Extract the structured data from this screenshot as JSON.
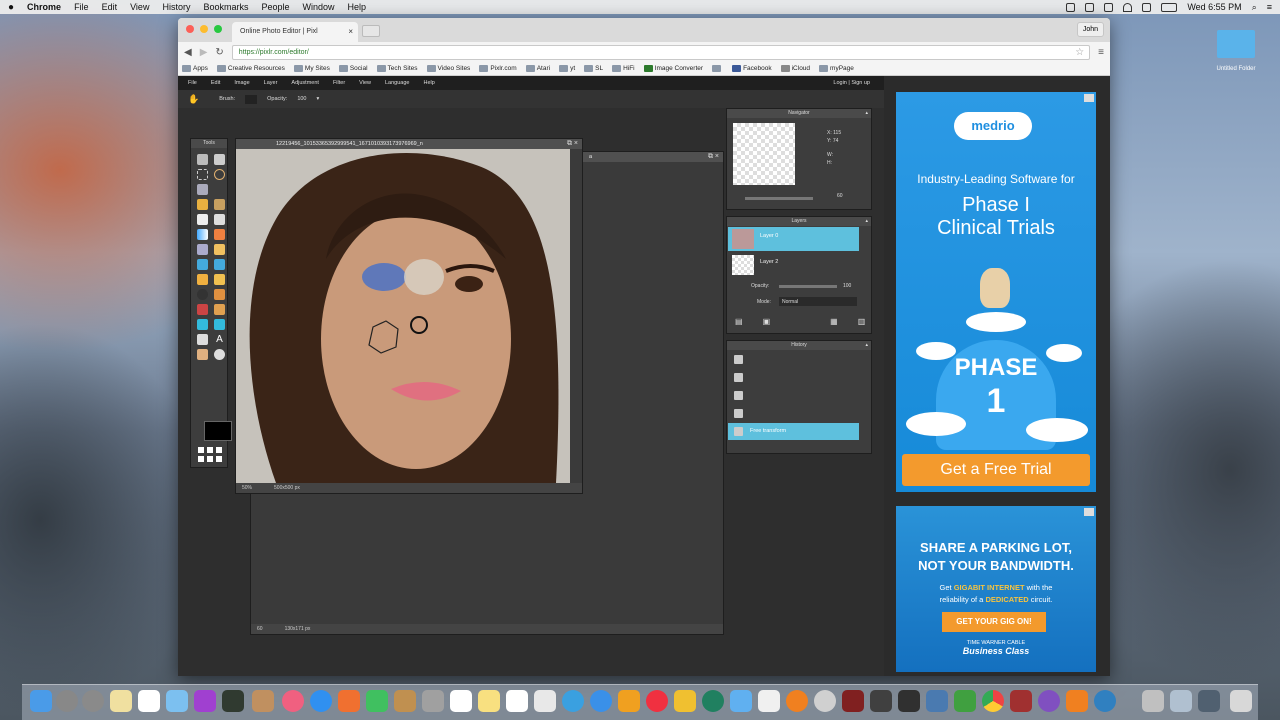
{
  "menubar": {
    "apple": "",
    "items": [
      "Chrome",
      "File",
      "Edit",
      "View",
      "History",
      "Bookmarks",
      "People",
      "Window",
      "Help"
    ],
    "clock": "Wed 6:55 PM"
  },
  "browser": {
    "tab_title": "Online Photo Editor | Pixl",
    "url": "https://pixlr.com/editor/",
    "profile": "John",
    "bookmarks": [
      "Apps",
      "Creative Resources",
      "My Sites",
      "Social",
      "Tech Sites",
      "Video Sites",
      "Pixlr.com",
      "Atari",
      "yt",
      "SL",
      "HiFi",
      "Image Converter",
      "Facebook",
      "iCloud",
      "myPage"
    ]
  },
  "pixlr": {
    "menu": [
      "File",
      "Edit",
      "Image",
      "Layer",
      "Adjustment",
      "Filter",
      "View",
      "Language",
      "Help"
    ],
    "login": "Login | Sign up",
    "options": {
      "brush_label": "Brush:",
      "opacity_label": "Opacity:",
      "opacity_value": "100"
    },
    "tools_title": "Tools",
    "doc1": {
      "title": "12219456_10153365392999541_1671010393173976969_n",
      "zoom": "50%",
      "size": "500x500 px"
    },
    "doc2": {
      "zoom": "60",
      "size": "130x171 px"
    },
    "navigator": {
      "title": "Navigator",
      "x_label": "X:",
      "x_value": "115",
      "y_label": "Y:",
      "y_value": "74",
      "w_label": "W:",
      "h_label": "H:",
      "zoom_value": "60"
    },
    "layers": {
      "title": "Layers",
      "items": [
        "Layer 0",
        "Layer 2"
      ],
      "opacity_label": "Opacity:",
      "opacity_value": "100",
      "mode_label": "Mode:",
      "mode_value": "Normal"
    },
    "history": {
      "title": "History",
      "items": [
        "",
        "",
        "",
        "",
        "Free transform"
      ]
    }
  },
  "ads": {
    "ad1": {
      "logo": "medrio",
      "line1": "Industry-Leading Software for",
      "line2": "Phase I",
      "line3": "Clinical Trials",
      "badge1": "PHASE",
      "badge2": "1",
      "cta": "Get a Free Trial"
    },
    "ad2": {
      "line1": "SHARE A PARKING LOT,",
      "line2": "NOT YOUR BANDWIDTH.",
      "line3a": "Get ",
      "line3b": "GIGABIT INTERNET",
      "line3c": " with the",
      "line4a": "reliability of a ",
      "line4b": "DEDICATED",
      "line4c": " circuit.",
      "cta": "GET YOUR GIG ON!",
      "brand1": "TIME WARNER CABLE",
      "brand2": "Business Class"
    }
  },
  "desktop_label": "Untitled Folder",
  "colors": {
    "accent": "#5ec0dd",
    "ad_blue": "#1f8fe0",
    "cta_orange": "#f39a2d"
  }
}
